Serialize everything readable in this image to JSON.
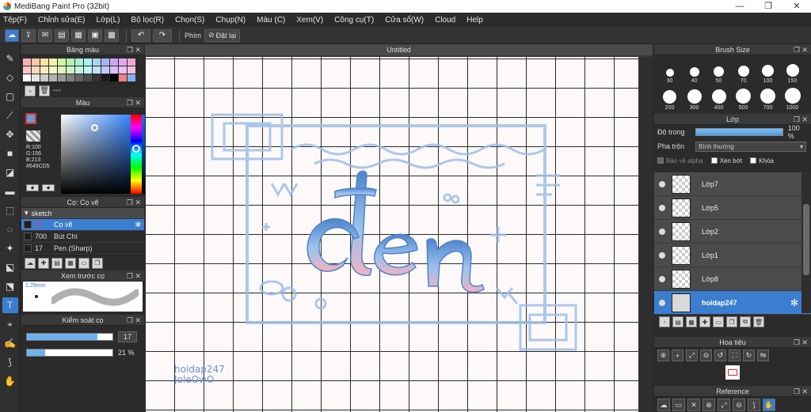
{
  "window": {
    "title": "MediBang Paint Pro (32bit)",
    "minimize": "—",
    "maximize": "❐",
    "close": "✕"
  },
  "menu": [
    "Tệp(F)",
    "Chỉnh sửa(E)",
    "Lớp(L)",
    "Bộ lọc(R)",
    "Chọn(S)",
    "Chụp(N)",
    "Màu (C)",
    "Xem(V)",
    "Công cụ(T)",
    "Cửa sổ(W)",
    "Cloud",
    "Help"
  ],
  "toolbar": {
    "key_label": "Phím",
    "reset_label": "Đặt lại"
  },
  "panels": {
    "palette": "Bảng màu",
    "color": "Màu",
    "brush": "Cọ: Cọ vẽ",
    "brush_preview": "Xem trước cọ",
    "brush_control": "Kiểm soát cọ",
    "document_tab": "Untitled",
    "brush_size": "Brush Size",
    "layer": "Lớp",
    "navigator": "Hoa tiêu",
    "reference": "Reference"
  },
  "palette": {
    "label": "---",
    "colors": [
      "#f7b3b3",
      "#f7c9a8",
      "#f7e3a8",
      "#f2f2a8",
      "#d2f2a8",
      "#b3f2b3",
      "#a8f2d2",
      "#a8f2f2",
      "#a8d2f2",
      "#a8b3f2",
      "#c9a8f2",
      "#e3a8f2",
      "#f2a8d2",
      "#f7c9c9",
      "#f7d9c0",
      "#f7ecc0",
      "#f5f5c0",
      "#e0f5c0",
      "#c9f5c9",
      "#c0f5e0",
      "#c0f5f5",
      "#c0e0f5",
      "#c0c9f5",
      "#d9c0f5",
      "#ecc0f5",
      "#f5c0e0",
      "#ffffff",
      "#e6e6e6",
      "#cccccc",
      "#b3b3b3",
      "#999999",
      "#808080",
      "#666666",
      "#4d4d4d",
      "#333333",
      "#1a1a1a",
      "#000000",
      "#f38080",
      "#80b3f3"
    ]
  },
  "color": {
    "r": "R:100",
    "g": "G:156",
    "b": "B:213",
    "hex": "#649CD5",
    "fg": "#649cd5"
  },
  "brushes": {
    "group": "sketch",
    "items": [
      {
        "size": "17",
        "name": "Cọ vẽ",
        "selected": true
      },
      {
        "size": "700",
        "name": "Bút Chì",
        "selected": false
      },
      {
        "size": "17",
        "name": "Pen (Sharp)",
        "selected": false
      }
    ]
  },
  "brush_preview": {
    "size": "1.29mm"
  },
  "brush_control": {
    "size_value": "17",
    "opacity_value": "21 %",
    "size_fraction": 0.82,
    "opacity_fraction": 0.21
  },
  "brush_sizes": [
    "30",
    "40",
    "50",
    "70",
    "100",
    "150",
    "200",
    "300",
    "400",
    "500",
    "700",
    "1000"
  ],
  "layer_panel": {
    "opacity_label": "Độ trong",
    "opacity_value": "100 %",
    "blend_label": "Pha trộn",
    "blend_value": "Bình thường",
    "protect_alpha": "Bảo vệ alpha",
    "clipping": "Xén bớt",
    "lock": "Khóa"
  },
  "layers": [
    {
      "name": "Lớp7",
      "selected": false
    },
    {
      "name": "Lớp5",
      "selected": false
    },
    {
      "name": "Lớp2",
      "selected": false
    },
    {
      "name": "Lớp1",
      "selected": false
    },
    {
      "name": "Lớp8",
      "selected": false
    },
    {
      "name": "hoidap247",
      "selected": true
    }
  ],
  "canvas": {
    "art_text": "den",
    "watermark_line1": "hoidap247",
    "watermark_line2": "JoleOwO"
  },
  "colors": {
    "accent": "#3b7ed0",
    "art_blue": "#4d84cc",
    "art_pink": "#f2b2c2",
    "frame_blue": "#9fbfe8"
  }
}
